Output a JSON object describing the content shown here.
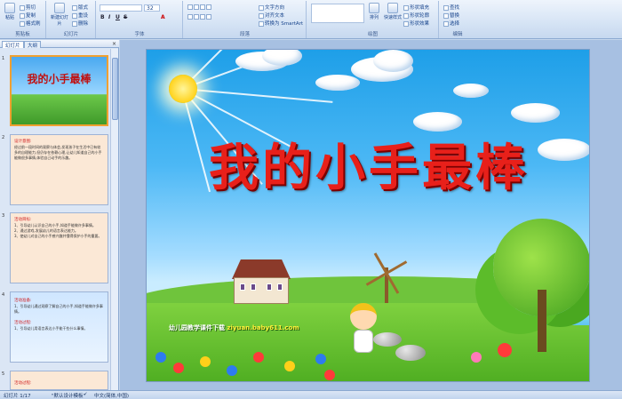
{
  "ribbon": {
    "groups": [
      {
        "label": "剪贴板",
        "buttons": [
          "粘贴",
          "剪切",
          "复制",
          "格式刷"
        ]
      },
      {
        "label": "幻灯片",
        "buttons": [
          "新建幻灯片",
          "版式",
          "重设",
          "删除"
        ]
      },
      {
        "label": "字体",
        "font_size": "32"
      },
      {
        "label": "段落",
        "buttons": [
          "文字方向",
          "对齐文本",
          "转换为 SmartArt"
        ]
      },
      {
        "label": "绘图",
        "buttons": [
          "排列",
          "快速样式",
          "形状填充",
          "形状轮廓",
          "形状效果"
        ]
      },
      {
        "label": "编辑",
        "buttons": [
          "查找",
          "替换",
          "选择"
        ]
      }
    ]
  },
  "panel": {
    "tabs": [
      "幻灯片",
      "大纲"
    ],
    "close": "×",
    "slide_numbers": [
      "1",
      "2",
      "3",
      "4",
      "5"
    ],
    "thumb1_title": "我的小手最棒",
    "thumb2": {
      "heading": "设计意图:",
      "text": "经过前一段时间的观察与体会,发现孩子在生活中已有较多的自理能力,但仍存在依赖心理,让幼儿知道自己的小手能做很多事情,体验自己动手的乐趣。"
    },
    "thumb3": {
      "heading": "活动目标:",
      "items": [
        "1、引导幼儿认识自己的小手,知道手能做许多事情。",
        "2、通过游戏,发展幼儿的语言表达能力。",
        "3、使幼儿对自己的小手感兴趣并懂得保护小手的重要。"
      ]
    },
    "thumb4": {
      "heading1": "活动准备:",
      "text1": "1、引导幼儿通过观察了解自己的小手,知道手能做许多事情。",
      "heading2": "活动过程:",
      "text2": "1、引导幼儿用语言表达小手能干些什么事情。"
    },
    "thumb5": {
      "heading": "活动过程:"
    }
  },
  "slide": {
    "title": "我的小手最棒",
    "caption_prefix": "幼儿园教学课件下载",
    "caption_url": "ziyuan.baby611.com"
  },
  "status": {
    "slide_count": "幻灯片 1/17",
    "theme": "\"默认设计模板\"",
    "language": "中文(简体,中国)"
  }
}
